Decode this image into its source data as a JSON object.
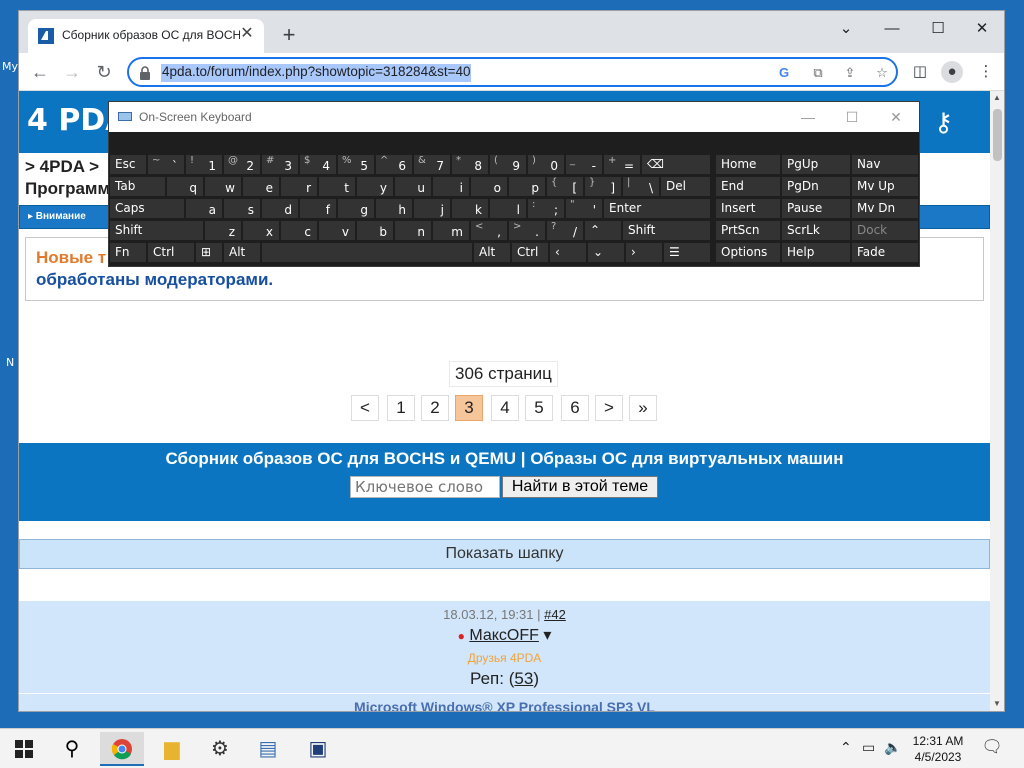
{
  "desktop": {
    "label_top": "My",
    "label_mid": "N"
  },
  "browser": {
    "tab_title": "Сборник образов ОС для BOCHS",
    "url": "4pda.to/forum/index.php?showtopic=318284&st=40",
    "new_tab": "+",
    "tab_close": "✕"
  },
  "site": {
    "logo": "4 PDA",
    "crumb1": "> 4PDA >",
    "crumb2": "Программ",
    "attention": "▸ Внимание",
    "notice_red": "Новые т",
    "notice_blue": "обработаны модераторами."
  },
  "pagination": {
    "count": "306 страниц",
    "buttons": [
      "<",
      "1",
      "2",
      "3",
      "4",
      "5",
      "6",
      ">",
      "»"
    ],
    "active": "3"
  },
  "topic": {
    "title": "Сборник образов ОС для BOCHS и QEMU | Образы ОС для виртуальных машин",
    "search_placeholder": "Ключевое слово",
    "search_button": "Найти в этой теме"
  },
  "show_header": "Показать шапку",
  "post": {
    "date": "18.03.12, 19:31",
    "sep": "|",
    "num": "#42",
    "user": "МаксOFF",
    "group": "Друзья 4PDA",
    "rep_label": "Реп:",
    "rep_value": "53",
    "content": "Microsoft Windows® XP Professional SP3 VL"
  },
  "osk": {
    "title": "On-Screen Keyboard",
    "row1": [
      {
        "alt": "~",
        "main": "`"
      },
      {
        "alt": "!",
        "main": "1"
      },
      {
        "alt": "@",
        "main": "2"
      },
      {
        "alt": "#",
        "main": "3"
      },
      {
        "alt": "$",
        "main": "4"
      },
      {
        "alt": "%",
        "main": "5"
      },
      {
        "alt": "^",
        "main": "6"
      },
      {
        "alt": "&",
        "main": "7"
      },
      {
        "alt": "*",
        "main": "8"
      },
      {
        "alt": "(",
        "main": "9"
      },
      {
        "alt": ")",
        "main": "0"
      },
      {
        "alt": "_",
        "main": "-"
      },
      {
        "alt": "+",
        "main": "="
      }
    ],
    "row2": [
      "q",
      "w",
      "e",
      "r",
      "t",
      "y",
      "u",
      "i",
      "o",
      "p"
    ],
    "row2_extra": [
      {
        "alt": "{",
        "main": "["
      },
      {
        "alt": "}",
        "main": "]"
      },
      {
        "alt": "|",
        "main": "\\"
      }
    ],
    "row3": [
      "a",
      "s",
      "d",
      "f",
      "g",
      "h",
      "j",
      "k",
      "l"
    ],
    "row3_extra": [
      {
        "alt": ":",
        "main": ";"
      },
      {
        "alt": "\"",
        "main": "'"
      }
    ],
    "row4": [
      "z",
      "x",
      "c",
      "v",
      "b",
      "n",
      "m"
    ],
    "row4_extra": [
      {
        "alt": "<",
        "main": ","
      },
      {
        "alt": ">",
        "main": "."
      },
      {
        "alt": "?",
        "main": "/"
      }
    ],
    "labels": {
      "esc": "Esc",
      "tab": "Tab",
      "caps": "Caps",
      "shift": "Shift",
      "fn": "Fn",
      "ctrl": "Ctrl",
      "alt": "Alt",
      "del": "Del",
      "enter": "Enter",
      "backspace": "⌫",
      "home": "Home",
      "pgup": "PgUp",
      "nav": "Nav",
      "end": "End",
      "pgdn": "PgDn",
      "mvup": "Mv Up",
      "insert": "Insert",
      "pause": "Pause",
      "mvdn": "Mv Dn",
      "prtscn": "PrtScn",
      "scrlk": "ScrLk",
      "dock": "Dock",
      "options": "Options",
      "help": "Help",
      "fade": "Fade"
    }
  },
  "taskbar": {
    "time": "12:31 AM",
    "date": "4/5/2023"
  }
}
